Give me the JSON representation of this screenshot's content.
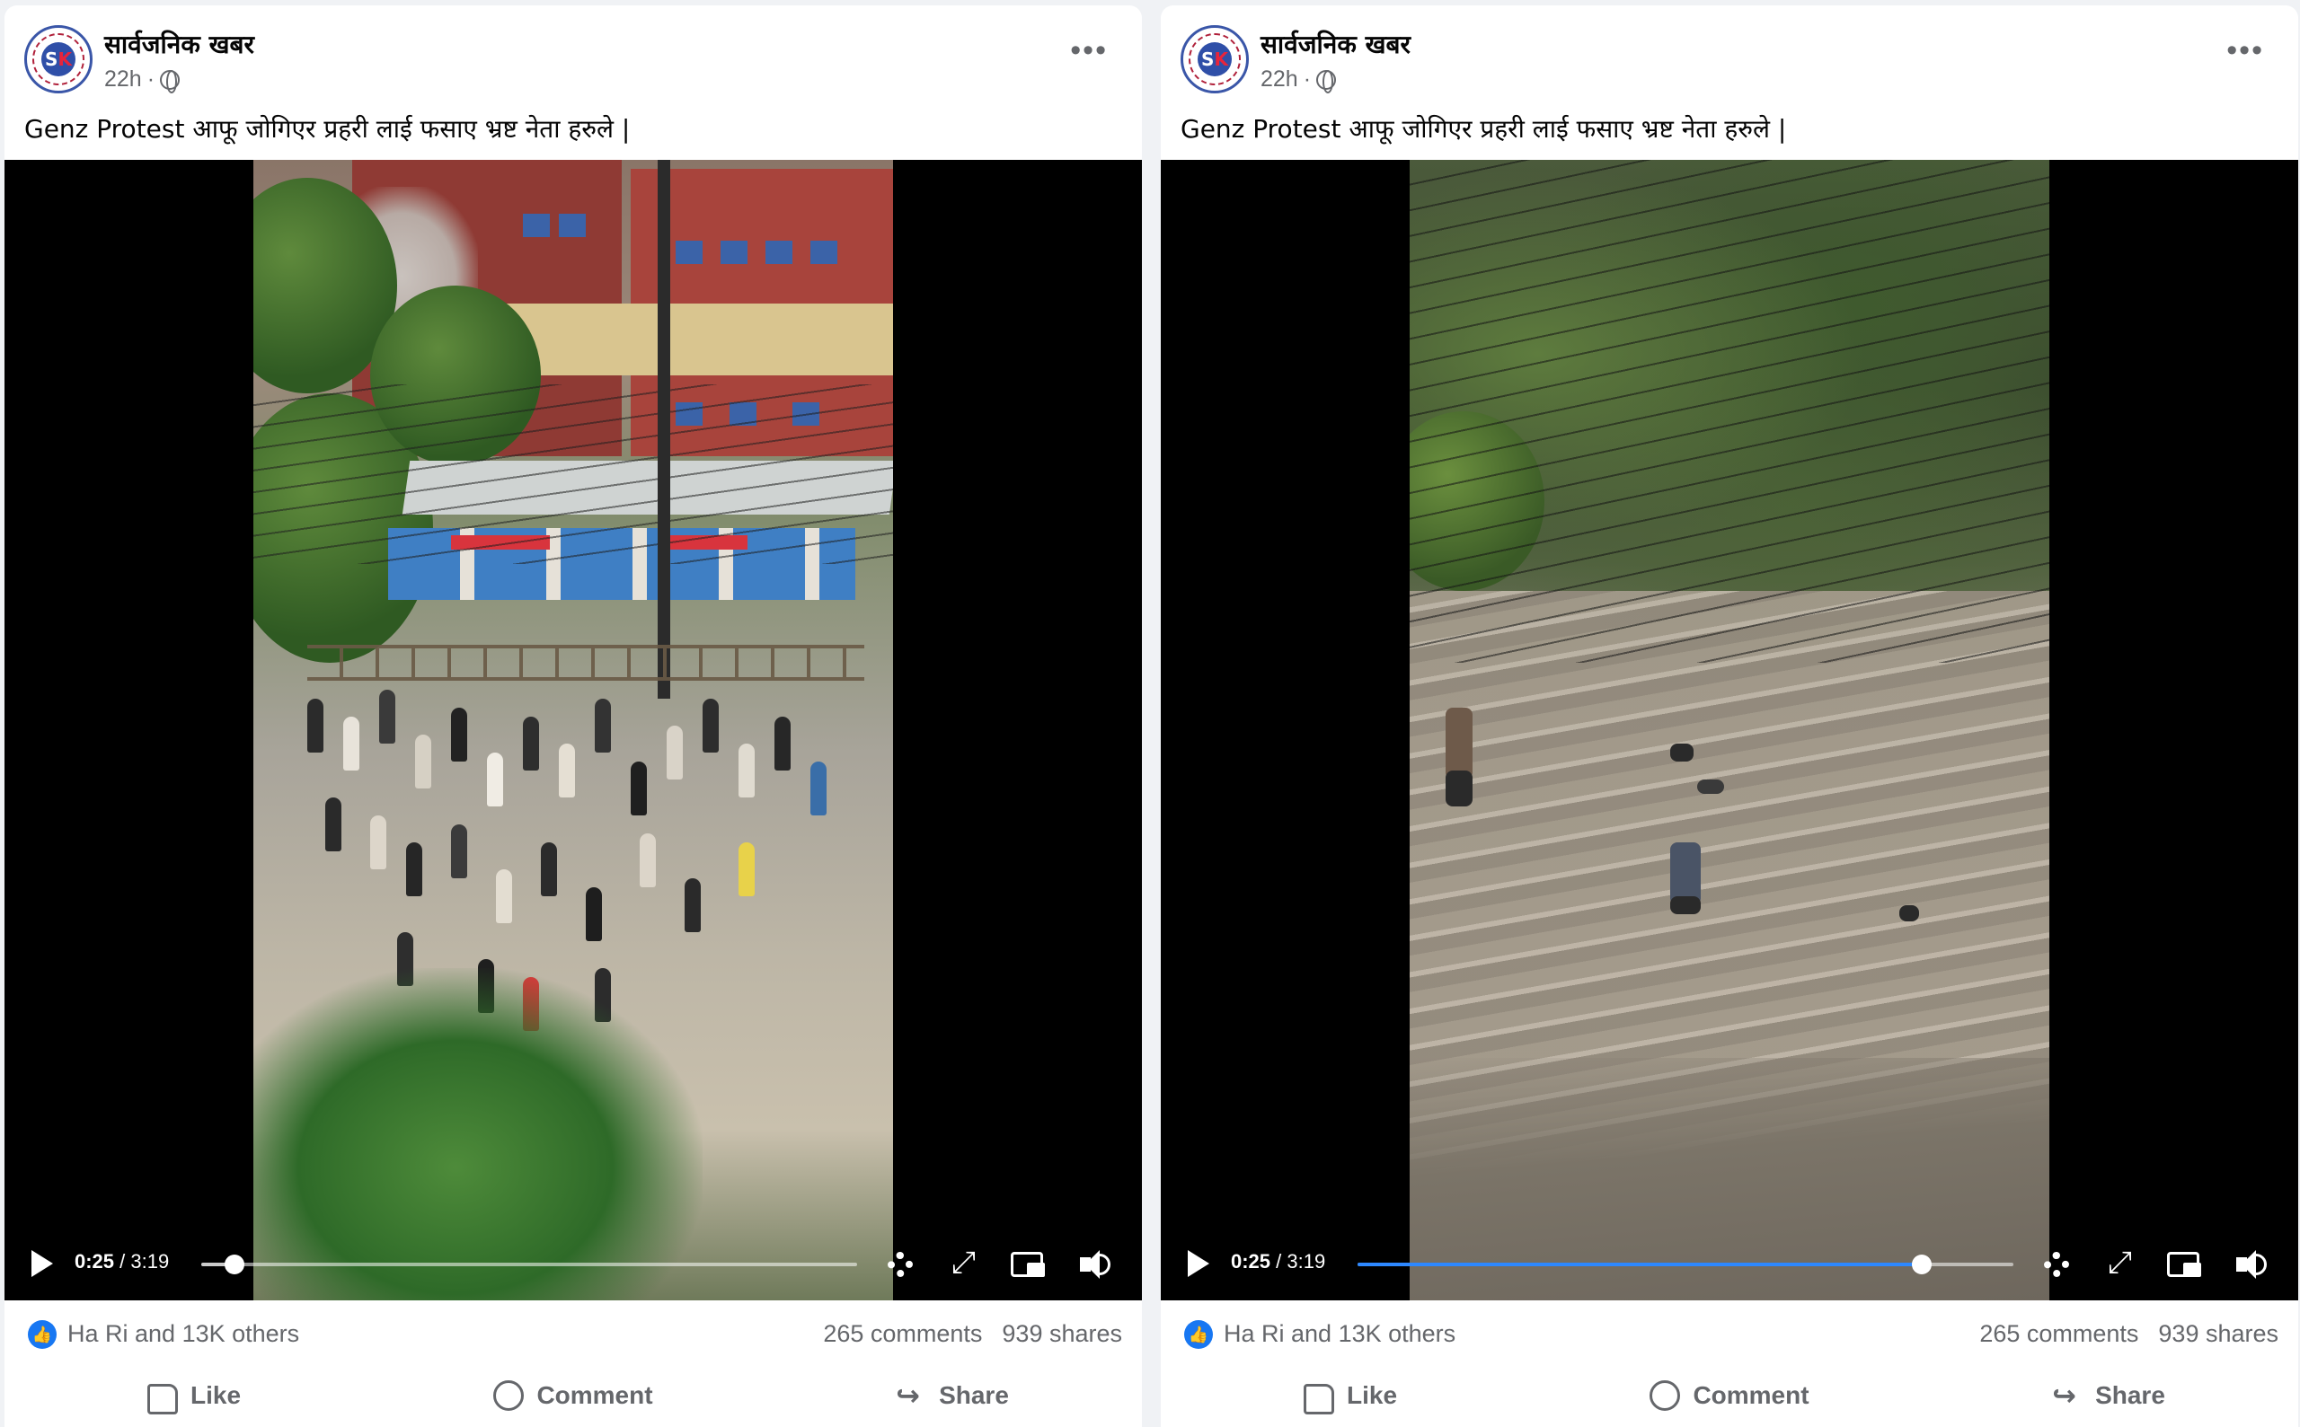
{
  "posts": [
    {
      "page_name": "सार्वजनिक खबर",
      "time": "22h",
      "separator": "·",
      "caption": "Genz Protest आफू जोगिएर प्रहरी लाई फसाए भ्रष्ट नेता हरुले |",
      "video": {
        "current_time": "0:25",
        "duration": "3:19",
        "time_separator": " / ",
        "progress": 0.05
      },
      "reactions": "Ha Ri and 13K others",
      "comments": "265 comments",
      "shares": "939 shares",
      "actions": {
        "like": "Like",
        "comment": "Comment",
        "share": "Share"
      }
    },
    {
      "page_name": "सार्वजनिक खबर",
      "time": "22h",
      "separator": "·",
      "caption": "Genz Protest आफू जोगिएर प्रहरी लाई फसाए भ्रष्ट नेता हरुले |",
      "video": {
        "current_time": "0:25",
        "duration": "3:19",
        "time_separator": " / ",
        "progress": 0.86
      },
      "reactions": "Ha Ri and 13K others",
      "comments": "265 comments",
      "shares": "939 shares",
      "actions": {
        "like": "Like",
        "comment": "Comment",
        "share": "Share"
      }
    }
  ],
  "icons": {
    "more": "more-options-icon",
    "privacy": "globe-icon",
    "play": "play-icon",
    "settings": "gear-icon",
    "fullscreen": "fullscreen-icon",
    "pip": "picture-in-picture-icon",
    "volume": "volume-icon",
    "like_badge": "like-reaction-icon"
  },
  "colors": {
    "accent": "#1877f2",
    "seek": "#2d88ff",
    "muted_text": "#65676b"
  }
}
